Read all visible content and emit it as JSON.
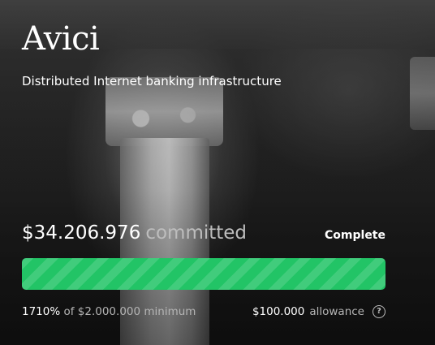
{
  "brand": {
    "name": "Avici"
  },
  "tagline": "Distributed Internet banking infrastructure",
  "funding": {
    "amount": "$34.206.976",
    "committed_label": "committed",
    "status": "Complete",
    "progress_percent": 100,
    "percent_of_min": "1710%",
    "minimum_text": "of $2.000.000 minimum",
    "allowance_amount": "$100.000",
    "allowance_label": "allowance"
  },
  "colors": {
    "progress": "#22c466"
  },
  "icons": {
    "help": "question-circle-icon"
  }
}
